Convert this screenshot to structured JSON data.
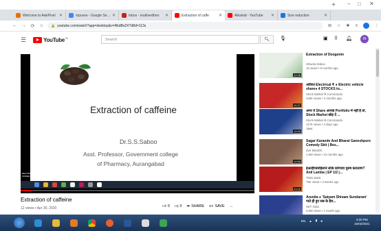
{
  "browser": {
    "tabs": [
      {
        "title": "Welcome to AwkPivel",
        "color": "#e37400",
        "active": false
      },
      {
        "title": "mpuvse - Google Search",
        "color": "#4285f4",
        "active": false
      },
      {
        "title": "Inbox - mukherdhen",
        "color": "#c5221f",
        "active": false
      },
      {
        "title": "Extraction of caffe",
        "color": "#ff0000",
        "active": true
      },
      {
        "title": "Alkaloid - YouTube",
        "color": "#ff0000",
        "active": false
      },
      {
        "title": "Size reduction",
        "color": "#1a73e8",
        "active": false
      }
    ],
    "new_tab": "+",
    "url": "youtube.com/watch?app=desktop&v=RkdBs2XTd8d=113s",
    "window_controls": [
      "–",
      "□",
      "✕"
    ]
  },
  "youtube": {
    "logo_text": "YouTube",
    "logo_region": "IN",
    "search_placeholder": "Search",
    "avatar_letter": "m"
  },
  "video": {
    "slide_title": "Extraction of caffeine",
    "slide_author": "Dr.S.S.Saboo",
    "slide_role_1": "Asst. Professor, Government college",
    "slide_role_2": "of Pharmacy, Aurangabad",
    "recording_badge": "RECORDED WITH SCREENCAST",
    "progress_fraction": 0.05,
    "title": "Extraction of caffeine",
    "meta": "12 views • Apr 30, 2020",
    "likes": "0",
    "dislikes": "0",
    "share_label": "SHARE",
    "save_label": "SAVE",
    "more_label": "..."
  },
  "sidebar": [
    {
      "title": "Extraction of Doogenin",
      "channel": "Shweta Saboo",
      "meta": "19 views • 9 months ago",
      "duration": "12:28",
      "new": "",
      "thumb": "#e8efe6",
      "accent": "#3c8d3c"
    },
    {
      "title": "अविरत Electrical ₹ ● Electric vehicle share● 4 STOCKS to...",
      "channel": "Stock Market के Commando",
      "meta": "245K views • 4 months ago",
      "duration": "10:37",
      "new": "",
      "thumb": "#c62828",
      "accent": "#ffeb3b"
    },
    {
      "title": "अगर ये Share आपके Portfolio में नहीं है तो, Stock Market छोड़ दें ...",
      "channel": "Stock Market के Commando",
      "meta": "117K views • 4 days ago",
      "duration": "11:00",
      "new": "New",
      "thumb": "#1e3f8a",
      "accent": "#ffffff"
    },
    {
      "title": "Sagar Karande And Bharat Ganeshpure Comedy Skit | Bes...",
      "channel": "Zee Marathi",
      "meta": "1.5M views • 10 months ago",
      "duration": "14:58",
      "new": "",
      "thumb": "#7a5a4a",
      "accent": "#f0c8a0"
    },
    {
      "title": "हेअरहैण्डमहिलाने लोके कोणावा पुरुष कराताण? Anil Lamba | EP 1/2 |...",
      "channel": "Think Bank",
      "meta": "79K views • 3 weeks ago",
      "duration": "21:01",
      "new": "",
      "thumb": "#b71c1c",
      "accent": "#ffd54f"
    },
    {
      "title": "Arunita ● 'Satyam Shivam Sundaram' गाते ही हुए सब के हैरा...",
      "channel": "SET India",
      "meta": "3.6M views • 1 month ago",
      "duration": "",
      "new": "",
      "thumb": "#2b3f8f",
      "accent": "#d0c0ff"
    }
  ],
  "windows": {
    "tray_lang": "EN",
    "time": "3:20 PM",
    "date": "16/02/2021"
  }
}
